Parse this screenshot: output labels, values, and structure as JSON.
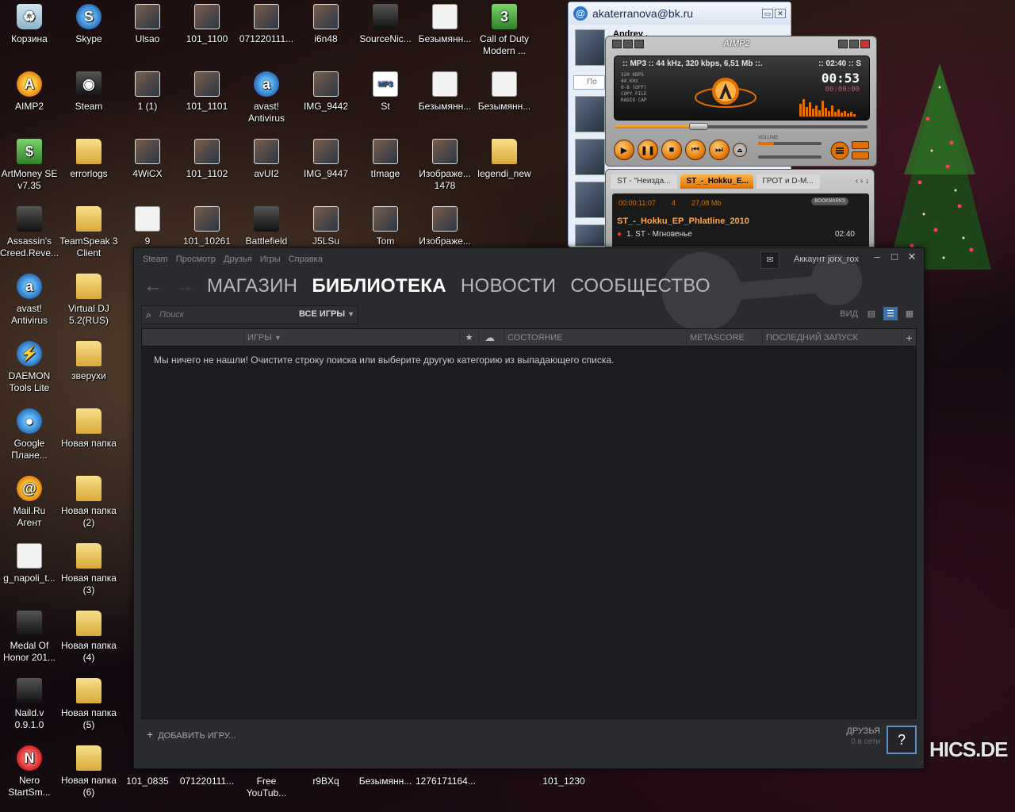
{
  "desktop_icons": [
    {
      "label": "Корзина",
      "glyph": "♻",
      "icon": "recycle-bin-icon",
      "type": "bin"
    },
    {
      "label": "Skype",
      "glyph": "S",
      "icon": "skype-icon",
      "type": "app-blue"
    },
    {
      "label": "Ulsao",
      "glyph": "",
      "icon": "image-file-icon",
      "type": "img"
    },
    {
      "label": "101_1100",
      "glyph": "",
      "icon": "image-file-icon",
      "type": "img"
    },
    {
      "label": "071220111...",
      "glyph": "",
      "icon": "image-file-icon",
      "type": "img"
    },
    {
      "label": "i6n48",
      "glyph": "",
      "icon": "image-file-icon",
      "type": "img"
    },
    {
      "label": "SourceNic...",
      "glyph": "",
      "icon": "app-icon",
      "type": "app-dark"
    },
    {
      "label": "Безымянн...",
      "glyph": "",
      "icon": "image-file-icon",
      "type": "doc"
    },
    {
      "label": "Call of Duty Modern ...",
      "glyph": "3",
      "icon": "call-of-duty-icon",
      "type": "green"
    },
    {
      "label": "AIMP2",
      "glyph": "A",
      "icon": "aimp-icon",
      "type": "app-orange"
    },
    {
      "label": "Steam",
      "glyph": "◉",
      "icon": "steam-icon",
      "type": "app-dark"
    },
    {
      "label": "1 (1)",
      "glyph": "",
      "icon": "image-file-icon",
      "type": "img"
    },
    {
      "label": "101_1101",
      "glyph": "",
      "icon": "image-file-icon",
      "type": "img"
    },
    {
      "label": "avast! Antivirus",
      "glyph": "a",
      "icon": "avast-icon",
      "type": "app-blue"
    },
    {
      "label": "IMG_9442",
      "glyph": "",
      "icon": "image-file-icon",
      "type": "img"
    },
    {
      "label": "St",
      "glyph": "MP3",
      "icon": "mp3-file-icon",
      "type": "mp3"
    },
    {
      "label": "Безымянн...",
      "glyph": "",
      "icon": "image-file-icon",
      "type": "doc"
    },
    {
      "label": "Безымянн...",
      "glyph": "",
      "icon": "image-file-icon",
      "type": "doc"
    },
    {
      "label": "ArtMoney SE v7.35",
      "glyph": "$",
      "icon": "artmoney-icon",
      "type": "green"
    },
    {
      "label": "errorlogs",
      "glyph": "",
      "icon": "folder-icon",
      "type": "folder"
    },
    {
      "label": "4WiCX",
      "glyph": "",
      "icon": "image-file-icon",
      "type": "img"
    },
    {
      "label": "101_1102",
      "glyph": "",
      "icon": "image-file-icon",
      "type": "img"
    },
    {
      "label": "avUI2",
      "glyph": "",
      "icon": "image-file-icon",
      "type": "img"
    },
    {
      "label": "IMG_9447",
      "glyph": "",
      "icon": "image-file-icon",
      "type": "img"
    },
    {
      "label": "tImage",
      "glyph": "",
      "icon": "image-file-icon",
      "type": "img"
    },
    {
      "label": "Изображе... 1478",
      "glyph": "",
      "icon": "image-file-icon",
      "type": "img"
    },
    {
      "label": "legendi_new",
      "glyph": "",
      "icon": "folder-icon",
      "type": "folder"
    },
    {
      "label": "Assassin's Creed.Reve...",
      "glyph": "",
      "icon": "assassins-creed-icon",
      "type": "app-dark"
    },
    {
      "label": "TeamSpeak 3 Client",
      "glyph": "",
      "icon": "folder-icon",
      "type": "folder"
    },
    {
      "label": "9",
      "glyph": "",
      "icon": "image-file-icon",
      "type": "doc"
    },
    {
      "label": "101_10261",
      "glyph": "",
      "icon": "image-file-icon",
      "type": "img"
    },
    {
      "label": "Battlefield",
      "glyph": "",
      "icon": "battlefield-icon",
      "type": "app-dark"
    },
    {
      "label": "J5LSu",
      "glyph": "",
      "icon": "image-file-icon",
      "type": "img"
    },
    {
      "label": "Tom",
      "glyph": "",
      "icon": "image-file-icon",
      "type": "img"
    },
    {
      "label": "Изображе...",
      "glyph": "",
      "icon": "image-file-icon",
      "type": "img"
    },
    {
      "label": "avast! Antivirus",
      "glyph": "a",
      "icon": "avast-icon",
      "type": "app-blue"
    },
    {
      "label": "Virtual DJ 5.2(RUS)",
      "glyph": "",
      "icon": "folder-icon",
      "type": "folder"
    },
    {
      "label": "DAEMON Tools Lite",
      "glyph": "⚡",
      "icon": "daemon-tools-icon",
      "type": "app-blue"
    },
    {
      "label": "зверухи",
      "glyph": "",
      "icon": "folder-icon",
      "type": "folder"
    },
    {
      "label": "Google Плане...",
      "glyph": "●",
      "icon": "google-earth-icon",
      "type": "app-blue"
    },
    {
      "label": "Новая папка",
      "glyph": "",
      "icon": "folder-icon",
      "type": "folder"
    },
    {
      "label": "Mail.Ru Агент",
      "glyph": "@",
      "icon": "mail-ru-agent-icon",
      "type": "app-orange"
    },
    {
      "label": "Новая папка (2)",
      "glyph": "",
      "icon": "folder-icon",
      "type": "folder"
    },
    {
      "label": "g_napoli_t...",
      "glyph": "",
      "icon": "image-file-icon",
      "type": "doc"
    },
    {
      "label": "Новая папка (3)",
      "glyph": "",
      "icon": "folder-icon",
      "type": "folder"
    },
    {
      "label": "Medal Of Honor 201...",
      "glyph": "",
      "icon": "medal-of-honor-icon",
      "type": "app-dark"
    },
    {
      "label": "Новая папка (4)",
      "glyph": "",
      "icon": "folder-icon",
      "type": "folder"
    },
    {
      "label": "Naild.v 0.9.1.0",
      "glyph": "",
      "icon": "naild-icon",
      "type": "app-dark"
    },
    {
      "label": "Новая папка (5)",
      "glyph": "",
      "icon": "folder-icon",
      "type": "folder"
    },
    {
      "label": "Nero StartSm...",
      "glyph": "N",
      "icon": "nero-icon",
      "type": "app-red"
    },
    {
      "label": "Новая папка (6)",
      "glyph": "",
      "icon": "folder-icon",
      "type": "folder"
    },
    {
      "label": "101_0835",
      "glyph": "",
      "icon": "image-file-icon",
      "type": "none"
    },
    {
      "label": "071220111...",
      "glyph": "",
      "icon": "image-file-icon",
      "type": "none"
    },
    {
      "label": "Free YouTub...",
      "glyph": "",
      "icon": "app-icon",
      "type": "none"
    },
    {
      "label": "r9BXq",
      "glyph": "",
      "icon": "image-file-icon",
      "type": "none"
    },
    {
      "label": "Безымянн...",
      "glyph": "",
      "icon": "image-file-icon",
      "type": "none"
    },
    {
      "label": "1276171164...",
      "glyph": "",
      "icon": "image-file-icon",
      "type": "none"
    },
    {
      "label": "101_1230",
      "glyph": "",
      "icon": "image-file-icon",
      "type": "none"
    }
  ],
  "agent": {
    "title": "akaterranova@bk.ru",
    "contact": "Andrey ,",
    "search_placeholder": "По",
    "minimize": "▭",
    "close": "✕"
  },
  "aimp": {
    "logo": "AIMP2",
    "info": ":: MP3 :: 44 kHz, 320 kbps, 6,51 Mb ::.",
    "time_small": ":: 02:40 :: S",
    "specs": [
      "320 KBPS",
      "44 KHz",
      "0-8 (OFF)",
      "COPY FILE",
      "RADIO CAP"
    ],
    "time_big": "00:53",
    "time_remain": "00:00:00",
    "progress": 0.33,
    "volume_label": "VOLUME",
    "volume": 0.25,
    "buttons": {
      "play": "▶",
      "pause": "❚❚",
      "stop": "■",
      "prev": "⏮",
      "next": "⏭",
      "eject": "⏏"
    },
    "playlist": {
      "tabs": [
        "ST - \"Неизда...",
        "ST_-_Hokku_E...",
        "ГРОТ и D-M..."
      ],
      "arrows": "‹ › ↓",
      "elapsed": "00:00:11:07",
      "count": "4",
      "size": "27,08 Mb",
      "bookmarks": "BOOKMARKS",
      "folder": "ST_-_Hokku_EP_Phlatline_2010",
      "track_title": "1. ST - Мгновенье",
      "track_duration": "02:40"
    }
  },
  "steam": {
    "menu": [
      "Steam",
      "Просмотр",
      "Друзья",
      "Игры",
      "Справка"
    ],
    "account": "Аккаунт jorx_rox",
    "nav": {
      "back": "←",
      "forward": "→",
      "links": [
        "МАГАЗИН",
        "БИБЛИОТЕКА",
        "НОВОСТИ",
        "СООБЩЕСТВО"
      ]
    },
    "search_placeholder": "Поиск",
    "filter": "ВСЕ ИГРЫ",
    "view_label": "ВИД",
    "columns": {
      "games": "ИГРЫ",
      "state": "СОСТОЯНИЕ",
      "metascore": "METASCORE",
      "last_launch": "ПОСЛЕДНИЙ ЗАПУСК"
    },
    "empty_message": "Мы ничего не нашли! Очистите строку поиска или выберите другую категорию из выпадающего списка.",
    "add_game": "ДОБАВИТЬ ИГРУ...",
    "friends_label": "ДРУЗЬЯ",
    "friends_status": "0 в сети",
    "help": "?"
  },
  "wallpaper": {
    "text": "HICS.DE"
  }
}
